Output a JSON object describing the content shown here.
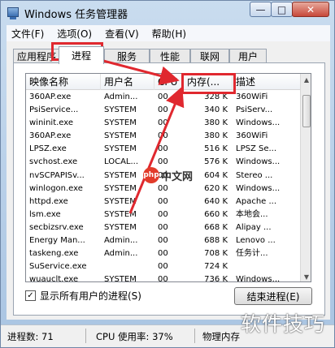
{
  "window": {
    "title": "Windows 任务管理器"
  },
  "titlebar_buttons": {
    "minimize": "—",
    "maximize": "□",
    "close": "✕"
  },
  "menu": [
    "文件(F)",
    "选项(O)",
    "查看(V)",
    "帮助(H)"
  ],
  "tabs": [
    "应用程序",
    "进程",
    "服务",
    "性能",
    "联网",
    "用户"
  ],
  "active_tab": "进程",
  "columns": [
    "映像名称",
    "用户名",
    "CPU",
    "内存(...",
    "描述"
  ],
  "processes": [
    [
      "360AP.exe",
      "Admin...",
      "00",
      "328 K",
      "360WiFi"
    ],
    [
      "PsiService...",
      "SYSTEM",
      "00",
      "340 K",
      "PsiServ..."
    ],
    [
      "wininit.exe",
      "SYSTEM",
      "00",
      "380 K",
      "Windows..."
    ],
    [
      "360AP.exe",
      "SYSTEM",
      "00",
      "380 K",
      "360WiFi"
    ],
    [
      "LPSZ.exe",
      "SYSTEM",
      "00",
      "516 K",
      "LPSZ Se..."
    ],
    [
      "svchost.exe",
      "LOCAL...",
      "00",
      "576 K",
      "Windows..."
    ],
    [
      "nvSCPAPISv...",
      "SYSTEM",
      "00",
      "604 K",
      "Stereo ..."
    ],
    [
      "winlogon.exe",
      "SYSTEM",
      "00",
      "620 K",
      "Windows..."
    ],
    [
      "httpd.exe",
      "SYSTEM",
      "00",
      "640 K",
      "Apache ..."
    ],
    [
      "lsm.exe",
      "SYSTEM",
      "00",
      "660 K",
      "本地会..."
    ],
    [
      "secbizsrv.exe",
      "SYSTEM",
      "00",
      "668 K",
      "Alipay ..."
    ],
    [
      "Energy Man...",
      "Admin...",
      "00",
      "688 K",
      "Lenovo ..."
    ],
    [
      "taskeng.exe",
      "Admin...",
      "00",
      "708 K",
      "任务计..."
    ],
    [
      "SuService.exe",
      "",
      "00",
      "724 K",
      ""
    ],
    [
      "wuauclt.exe",
      "SYSTEM",
      "00",
      "736 K",
      "Windows..."
    ]
  ],
  "show_all_processes": {
    "label": "显示所有用户的进程(S)",
    "checked": "✓"
  },
  "end_process_button": "结束进程(E)",
  "status": {
    "process_count": "进程数: 71",
    "cpu_usage": "CPU 使用率: 37%",
    "physical_memory": "物理内存"
  },
  "watermark": {
    "logo_text": "php",
    "logo_site": "中文网",
    "corner_text": "软件技巧"
  },
  "annotation_color": "#e0282f"
}
